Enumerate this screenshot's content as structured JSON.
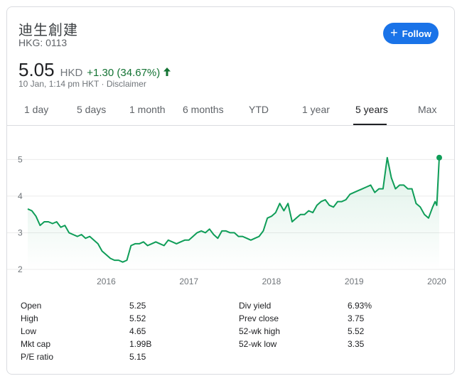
{
  "company": {
    "name": "迪生創建",
    "ticker": "HKG: 0113"
  },
  "follow_button": {
    "label": "Follow",
    "icon": "plus-icon"
  },
  "quote": {
    "price": "5.05",
    "currency": "HKD",
    "change": "+1.30 (34.67%)",
    "direction": "up",
    "timestamp": "10 Jan, 1:14 pm HKT · Disclaimer"
  },
  "colors": {
    "up": "#137333",
    "line": "#0f9d58",
    "accent": "#1a73e8"
  },
  "tabs": [
    {
      "label": "1 day",
      "active": false
    },
    {
      "label": "5 days",
      "active": false
    },
    {
      "label": "1 month",
      "active": false
    },
    {
      "label": "6 months",
      "active": false
    },
    {
      "label": "YTD",
      "active": false
    },
    {
      "label": "1 year",
      "active": false
    },
    {
      "label": "5 years",
      "active": true
    },
    {
      "label": "Max",
      "active": false
    }
  ],
  "chart_data": {
    "type": "area",
    "title": "",
    "xlabel": "",
    "ylabel": "",
    "x_ticks": [
      "2016",
      "2017",
      "2018",
      "2019",
      "2020"
    ],
    "y_ticks": [
      "2",
      "3",
      "4",
      "5"
    ],
    "ylim": [
      2,
      5.2
    ],
    "xlim": [
      2015.05,
      2020.03
    ],
    "grid": true,
    "series": [
      {
        "x": [
          2015.05,
          2015.1,
          2015.15,
          2015.2,
          2015.25,
          2015.3,
          2015.35,
          2015.4,
          2015.45,
          2015.5,
          2015.55,
          2015.6,
          2015.65,
          2015.7,
          2015.75,
          2015.8,
          2015.85,
          2015.9,
          2015.95,
          2016.0,
          2016.05,
          2016.1,
          2016.15,
          2016.2,
          2016.25,
          2016.3,
          2016.35,
          2016.4,
          2016.45,
          2016.5,
          2016.55,
          2016.6,
          2016.65,
          2016.7,
          2016.75,
          2016.8,
          2016.85,
          2016.9,
          2016.95,
          2017.0,
          2017.05,
          2017.1,
          2017.15,
          2017.2,
          2017.25,
          2017.3,
          2017.35,
          2017.4,
          2017.45,
          2017.5,
          2017.55,
          2017.6,
          2017.65,
          2017.7,
          2017.75,
          2017.8,
          2017.85,
          2017.9,
          2017.95,
          2018.0,
          2018.05,
          2018.1,
          2018.15,
          2018.2,
          2018.25,
          2018.3,
          2018.35,
          2018.4,
          2018.45,
          2018.5,
          2018.55,
          2018.6,
          2018.65,
          2018.7,
          2018.75,
          2018.8,
          2018.85,
          2018.9,
          2018.95,
          2019.0,
          2019.05,
          2019.1,
          2019.15,
          2019.2,
          2019.25,
          2019.3,
          2019.35,
          2019.4,
          2019.45,
          2019.5,
          2019.55,
          2019.6,
          2019.65,
          2019.7,
          2019.75,
          2019.8,
          2019.85,
          2019.9,
          2019.95,
          2019.98,
          2020.0,
          2020.03
        ],
        "values": [
          3.65,
          3.6,
          3.45,
          3.2,
          3.3,
          3.3,
          3.25,
          3.3,
          3.15,
          3.2,
          3.0,
          2.95,
          2.9,
          2.95,
          2.85,
          2.9,
          2.8,
          2.7,
          2.5,
          2.4,
          2.3,
          2.25,
          2.25,
          2.2,
          2.25,
          2.65,
          2.7,
          2.7,
          2.75,
          2.65,
          2.7,
          2.75,
          2.7,
          2.65,
          2.8,
          2.75,
          2.7,
          2.75,
          2.8,
          2.8,
          2.9,
          3.0,
          3.05,
          3.0,
          3.1,
          2.95,
          2.85,
          3.05,
          3.05,
          3.0,
          3.0,
          2.9,
          2.9,
          2.85,
          2.8,
          2.85,
          2.9,
          3.05,
          3.4,
          3.45,
          3.55,
          3.8,
          3.6,
          3.8,
          3.3,
          3.4,
          3.5,
          3.5,
          3.6,
          3.55,
          3.75,
          3.85,
          3.9,
          3.75,
          3.7,
          3.85,
          3.85,
          3.9,
          4.05,
          4.1,
          4.15,
          4.2,
          4.25,
          4.3,
          4.1,
          4.2,
          4.2,
          5.05,
          4.5,
          4.2,
          4.3,
          4.3,
          4.2,
          4.2,
          3.8,
          3.7,
          3.5,
          3.4,
          3.7,
          3.85,
          3.75,
          5.05
        ]
      }
    ]
  },
  "stats": {
    "left": [
      {
        "label": "Open",
        "value": "5.25"
      },
      {
        "label": "High",
        "value": "5.52"
      },
      {
        "label": "Low",
        "value": "4.65"
      },
      {
        "label": "Mkt cap",
        "value": "1.99B"
      },
      {
        "label": "P/E ratio",
        "value": "5.15"
      }
    ],
    "right": [
      {
        "label": "Div yield",
        "value": "6.93%"
      },
      {
        "label": "Prev close",
        "value": "3.75"
      },
      {
        "label": "52-wk high",
        "value": "5.52"
      },
      {
        "label": "52-wk low",
        "value": "3.35"
      }
    ]
  }
}
